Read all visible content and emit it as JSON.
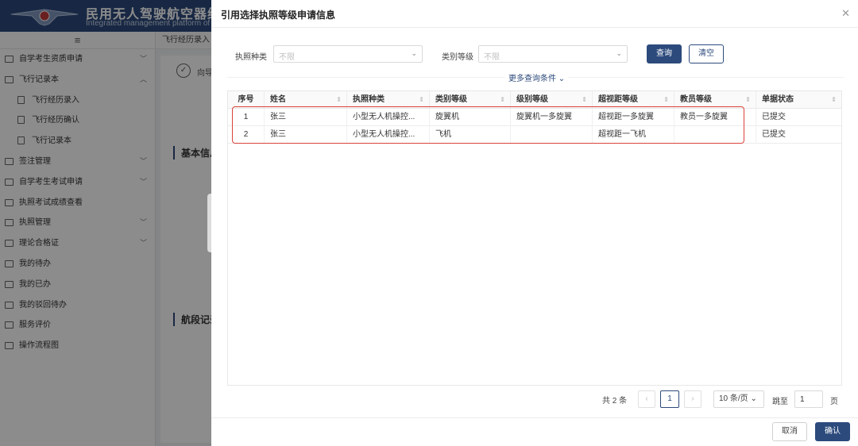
{
  "app": {
    "title": "民用无人驾驶航空器综合管",
    "subtitle": "Integrated management platform of civ"
  },
  "sidebar": {
    "toggle_icon": "≡",
    "items": [
      {
        "label": "自学考生资质申请",
        "expand": "﹀"
      },
      {
        "label": "飞行记录本",
        "expand": "︿"
      },
      {
        "label": "飞行经历录入"
      },
      {
        "label": "飞行经历确认"
      },
      {
        "label": "飞行记录本"
      },
      {
        "label": "签注管理",
        "expand": "﹀"
      },
      {
        "label": "自学考生考试申请",
        "expand": "﹀"
      },
      {
        "label": "执照考试成绩查看"
      },
      {
        "label": "执照管理",
        "expand": "﹀"
      },
      {
        "label": "理论合格证",
        "expand": "﹀"
      },
      {
        "label": "我的待办"
      },
      {
        "label": "我的已办"
      },
      {
        "label": "我的驳回待办"
      },
      {
        "label": "服务评价"
      },
      {
        "label": "操作流程图"
      }
    ]
  },
  "main": {
    "tab_active": "飞行经历录入",
    "step_label": "向导",
    "section_basic": "基本信息",
    "section_flight": "航段记录"
  },
  "drawer": {
    "title": "引用选择执照等级申请信息",
    "close_icon": "✕",
    "filters": {
      "license_type_label": "执照种类",
      "license_type_placeholder": "不限",
      "category_label": "类别等级",
      "category_placeholder": "不限",
      "dropdown_icon": "⌄"
    },
    "query_button": "查询",
    "clear_button": "清空",
    "more_filters": "更多查询条件 ⌄",
    "table": {
      "sort_icon": "⇕",
      "columns": [
        "序号",
        "姓名",
        "执照种类",
        "类别等级",
        "级别等级",
        "超视距等级",
        "教员等级",
        "单据状态"
      ],
      "rows": [
        [
          "1",
          "张三",
          "小型无人机操控...",
          "旋翼机",
          "旋翼机一多旋翼",
          "超视距一多旋翼",
          "教员一多旋翼",
          "已提交"
        ],
        [
          "2",
          "张三",
          "小型无人机操控...",
          "飞机",
          "",
          "超视距一飞机",
          "",
          "已提交"
        ]
      ]
    },
    "highlight_color": "#d9433a",
    "pagination": {
      "total": "共 2 条",
      "prev": "‹",
      "current_page": "1",
      "next": "›",
      "page_size": "10 条/页 ⌄",
      "jump_label": "跳至",
      "jump_value": "1",
      "page_unit": "页"
    },
    "cancel_button": "取消",
    "confirm_button": "确认"
  },
  "colors": {
    "primary": "#2c4a7c",
    "overlay": "rgba(0,0,0,0.45)"
  }
}
